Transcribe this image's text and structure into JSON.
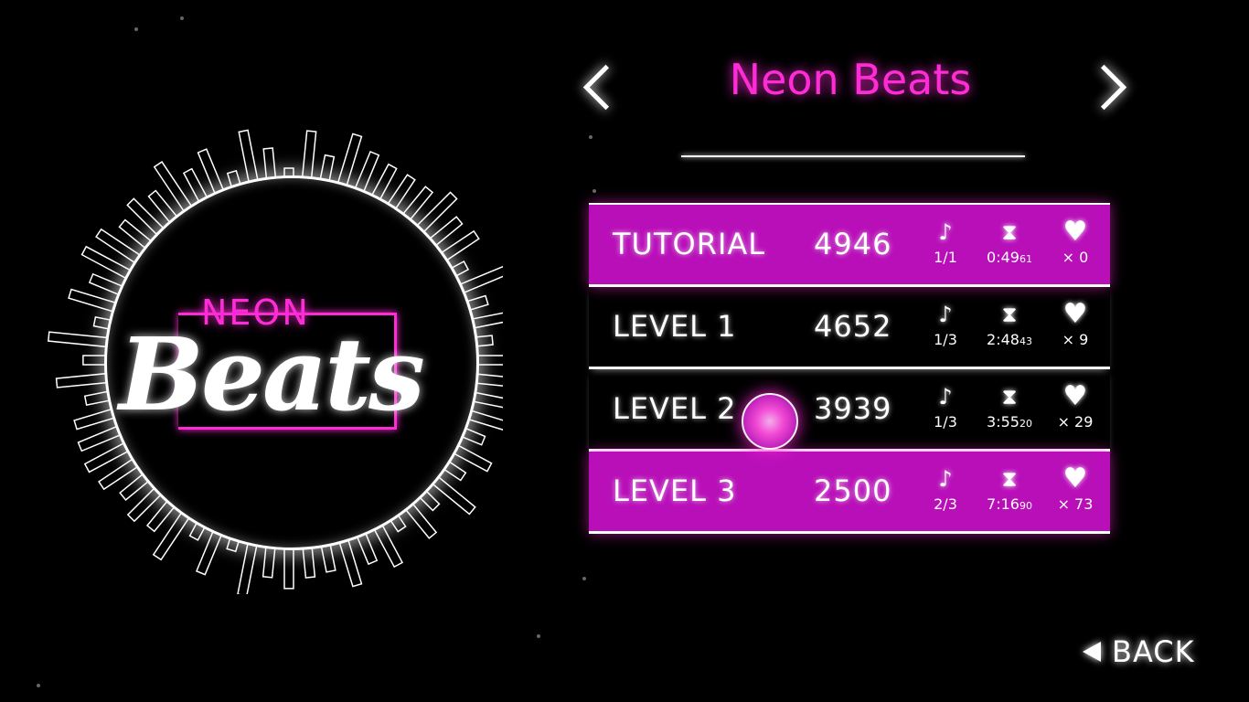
{
  "song": {
    "title": "Neon Beats",
    "logo_top": "NEON",
    "logo_main": "Beats"
  },
  "levels": [
    {
      "name": "TUTORIAL",
      "score": "4946",
      "notes": "1/1",
      "time": "0:49",
      "time_ms": "61",
      "hits": "× 0",
      "heart": "whole-heart-icon",
      "selected": true
    },
    {
      "name": "LEVEL 1",
      "score": "4652",
      "notes": "1/3",
      "time": "2:48",
      "time_ms": "43",
      "hits": "× 9",
      "heart": "broken-heart-icon",
      "selected": false
    },
    {
      "name": "LEVEL 2",
      "score": "3939",
      "notes": "1/3",
      "time": "3:55",
      "time_ms": "20",
      "hits": "× 29",
      "heart": "broken-heart-icon",
      "selected": false
    },
    {
      "name": "LEVEL 3",
      "score": "2500",
      "notes": "2/3",
      "time": "7:16",
      "time_ms": "90",
      "hits": "× 73",
      "heart": "broken-heart-icon",
      "selected": true
    }
  ],
  "back": {
    "label": "BACK"
  },
  "colors": {
    "accent": "#ff2bd6",
    "row_highlight": "#b80fb8"
  }
}
